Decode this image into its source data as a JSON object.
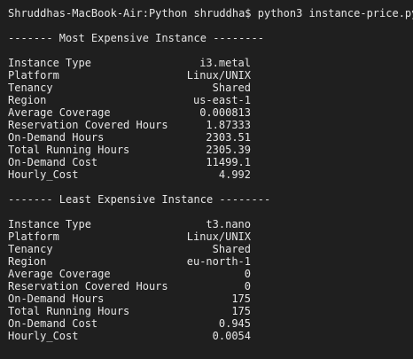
{
  "terminal": {
    "prompt_line": "Shruddhas-MacBook-Air:Python shruddha$ python3 instance-price.py",
    "sections": [
      {
        "header": "------- Most Expensive Instance --------",
        "rows": [
          {
            "label": "Instance Type",
            "value": "i3.metal"
          },
          {
            "label": "Platform",
            "value": "Linux/UNIX"
          },
          {
            "label": "Tenancy",
            "value": "Shared"
          },
          {
            "label": "Region",
            "value": "us-east-1"
          },
          {
            "label": "Average Coverage",
            "value": "0.000813"
          },
          {
            "label": "Reservation Covered Hours",
            "value": "1.87333"
          },
          {
            "label": "On-Demand Hours",
            "value": "2303.51"
          },
          {
            "label": "Total Running Hours",
            "value": "2305.39"
          },
          {
            "label": "On-Demand Cost",
            "value": "11499.1"
          },
          {
            "label": "Hourly_Cost",
            "value": "4.992"
          }
        ]
      },
      {
        "header": "------- Least Expensive Instance --------",
        "rows": [
          {
            "label": "Instance Type",
            "value": "t3.nano"
          },
          {
            "label": "Platform",
            "value": "Linux/UNIX"
          },
          {
            "label": "Tenancy",
            "value": "Shared"
          },
          {
            "label": "Region",
            "value": "eu-north-1"
          },
          {
            "label": "Average Coverage",
            "value": "0"
          },
          {
            "label": "Reservation Covered Hours",
            "value": "0"
          },
          {
            "label": "On-Demand Hours",
            "value": "175"
          },
          {
            "label": "Total Running Hours",
            "value": "175"
          },
          {
            "label": "On-Demand Cost",
            "value": "0.945"
          },
          {
            "label": "Hourly_Cost",
            "value": "0.0054"
          }
        ]
      }
    ]
  },
  "colors": {
    "background": "#1f1f1f",
    "text": "#e6e6e6"
  }
}
